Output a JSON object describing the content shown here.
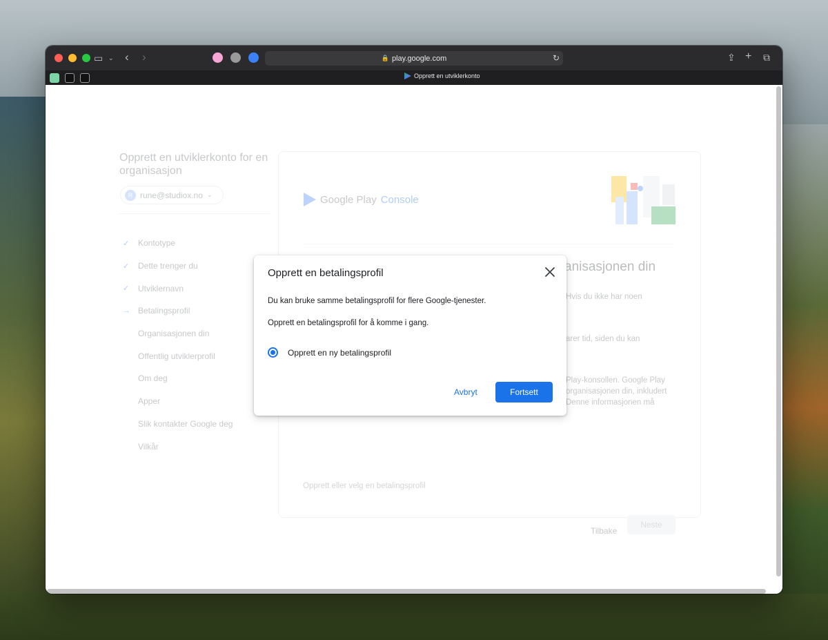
{
  "browser": {
    "url": "play.google.com",
    "tab_title": "Opprett en utviklerkonto"
  },
  "sidebar": {
    "title": "Opprett en utviklerkonto for en organisasjon",
    "account_initial": "R",
    "account_email": "rune@studiox.no",
    "steps": [
      {
        "label": "Kontotype",
        "mark": "✓"
      },
      {
        "label": "Dette trenger du",
        "mark": "✓"
      },
      {
        "label": "Utviklernavn",
        "mark": "✓"
      },
      {
        "label": "Betalingsprofil",
        "mark": "→"
      },
      {
        "label": "Organisasjonen din",
        "mark": ""
      },
      {
        "label": "Offentlig utviklerprofil",
        "mark": ""
      },
      {
        "label": "Om deg",
        "mark": ""
      },
      {
        "label": "Apper",
        "mark": ""
      },
      {
        "label": "Slik kontakter Google deg",
        "mark": ""
      },
      {
        "label": "Vilkår",
        "mark": ""
      }
    ]
  },
  "main": {
    "logo_google_play": "Google Play",
    "logo_console": "Console",
    "heading_fragment": "anisasjonen din",
    "fragments": [
      "Hvis du ikke har noen",
      "arer tid, siden du kan",
      "Play-konsollen. Google Play",
      "organisasjonen din, inkludert",
      "Denne informasjonen må"
    ],
    "link_text": "Opprett eller velg en betalingsprofil",
    "back_label": "Tilbake",
    "next_label": "Neste"
  },
  "dialog": {
    "title": "Opprett en betalingsprofil",
    "line1": "Du kan bruke samme betalingsprofil for flere Google-tjenester.",
    "line2": "Opprett en betalingsprofil for å komme i gang.",
    "option_label": "Opprett en ny betalingsprofil",
    "cancel_label": "Avbryt",
    "continue_label": "Fortsett"
  },
  "colors": {
    "accent": "#1a73e8",
    "titlebar": "#2b2b2d"
  }
}
